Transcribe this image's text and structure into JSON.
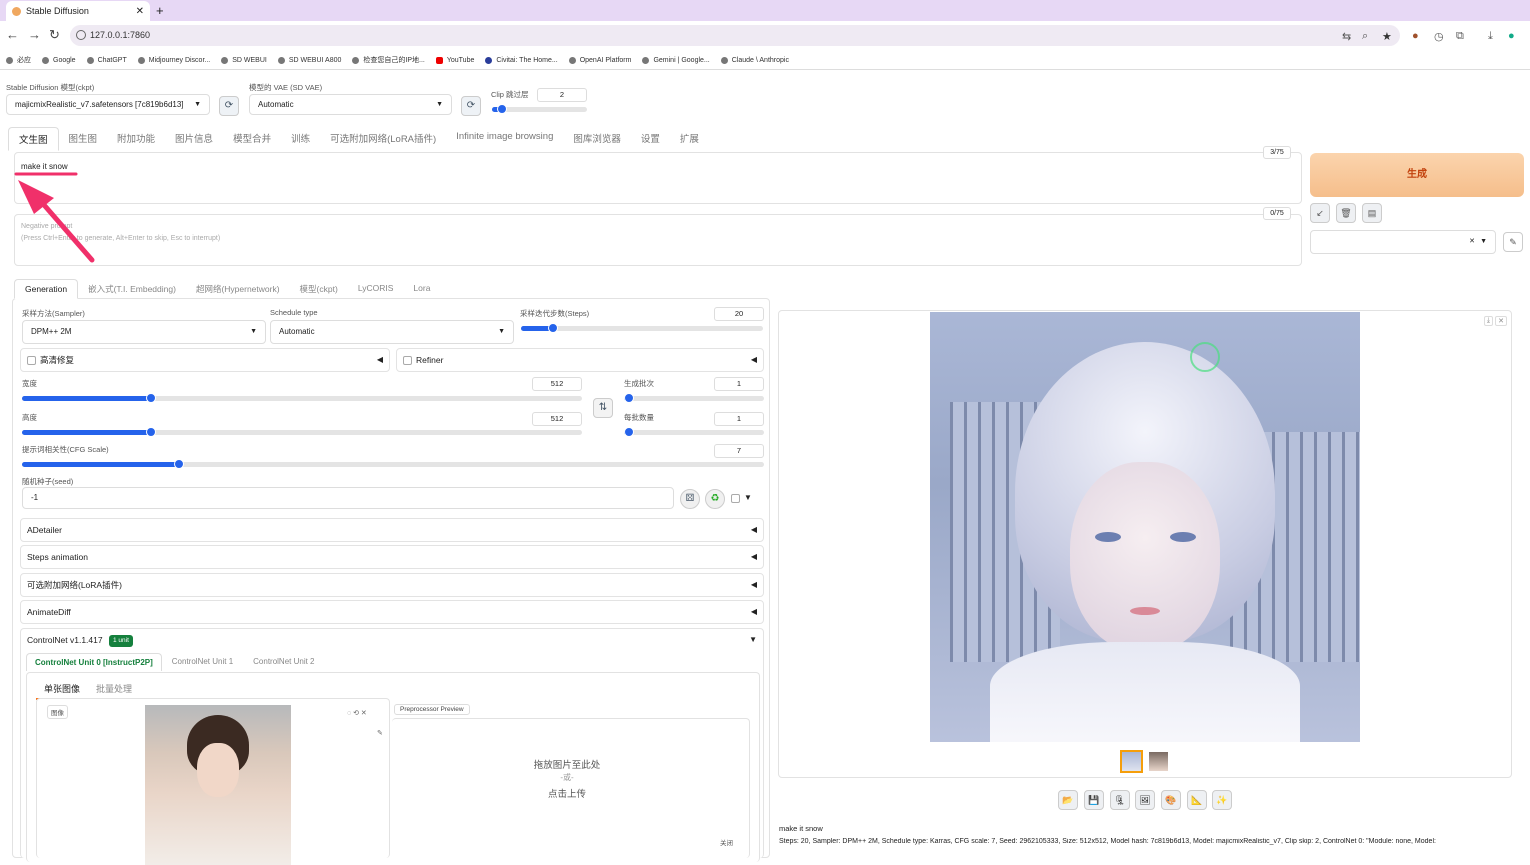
{
  "browser": {
    "tab_title": "Stable Diffusion",
    "new_tab": "+",
    "url": "127.0.0.1:7860",
    "bookmarks": [
      "必应",
      "Google",
      "ChatGPT",
      "Midjourney Discor...",
      "SD WEBUI",
      "SD WEBUI A800",
      "检查您自己的IP地...",
      "YouTube",
      "Civitai: The Home...",
      "OpenAI Platform",
      "Gemini | Google...",
      "Claude \\ Anthropic"
    ]
  },
  "top_settings": {
    "model_label": "Stable Diffusion 模型(ckpt)",
    "model_value": "majicmixRealistic_v7.safetensors [7c819b6d13]",
    "vae_label": "模型的 VAE (SD VAE)",
    "vae_value": "Automatic",
    "clip_label": "Clip 跳过层",
    "clip_value": "2"
  },
  "main_tabs": [
    "文生图",
    "图生图",
    "附加功能",
    "图片信息",
    "模型合并",
    "训练",
    "可选附加网络(LoRA插件)",
    "Infinite image browsing",
    "图库浏览器",
    "设置",
    "扩展"
  ],
  "prompt": {
    "text": "make it snow",
    "counter": "3/75",
    "neg_counter": "0/75",
    "neg_placeholder_1": "Negative prompt",
    "neg_placeholder_2": "(Press Ctrl+Enter to generate, Alt+Enter to skip, Esc to interrupt)"
  },
  "generate_label": "生成",
  "sub_tabs": [
    "Generation",
    "嵌入式(T.I. Embedding)",
    "超网络(Hypernetwork)",
    "模型(ckpt)",
    "LyCORIS",
    "Lora"
  ],
  "params": {
    "sampler_label": "采样方法(Sampler)",
    "sampler_value": "DPM++ 2M",
    "schedule_label": "Schedule type",
    "schedule_value": "Automatic",
    "steps_label": "采样迭代步数(Steps)",
    "steps_value": 20,
    "hires_label": "高清修复",
    "refiner_label": "Refiner",
    "width_label": "宽度",
    "width_value": 512,
    "height_label": "高度",
    "height_value": 512,
    "batch_count_label": "生成批次",
    "batch_count_value": 1,
    "batch_size_label": "每批数量",
    "batch_size_value": 1,
    "cfg_label": "提示词相关性(CFG Scale)",
    "cfg_value": 7,
    "seed_label": "随机种子(seed)",
    "seed_value": "-1"
  },
  "accordions": [
    "ADetailer",
    "Steps animation",
    "可选附加网络(LoRA插件)",
    "AnimateDiff"
  ],
  "controlnet": {
    "title": "ControlNet v1.1.417",
    "badge": "1 unit",
    "units": [
      "ControlNet Unit 0 [InstructP2P]",
      "ControlNet Unit 1",
      "ControlNet Unit 2"
    ],
    "modes": [
      "单张图像",
      "批量处理"
    ],
    "image_label": "图像",
    "preview_label": "Preprocessor Preview",
    "drop_1": "拖放图片至此处",
    "drop_2": "-或-",
    "drop_3": "点击上传",
    "close": "关闭"
  },
  "output": {
    "caption": "make it snow",
    "info": "Steps: 20, Sampler: DPM++ 2M, Schedule type: Karras, CFG scale: 7, Seed: 2962105333, Size: 512x512, Model hash: 7c819b6d13, Model: majicmixRealistic_v7, Clip skip: 2, ControlNet 0: \"Module: none, Model:"
  },
  "colors": {
    "accent": "#2563eb",
    "generate_bg": "#f5be8b",
    "annotation": "#f0306a"
  }
}
